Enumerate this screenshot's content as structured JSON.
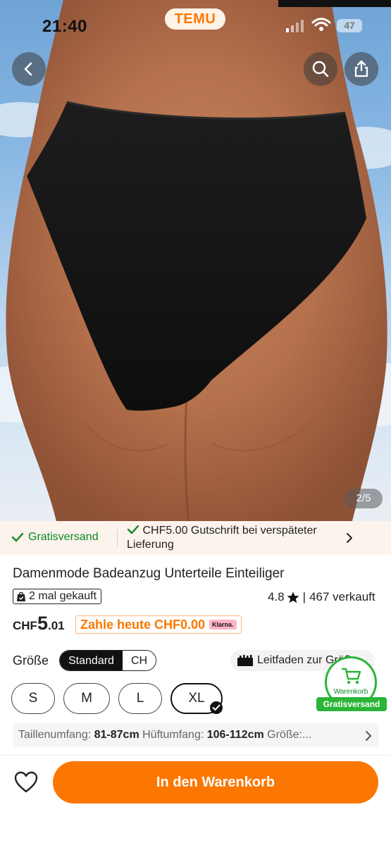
{
  "status_bar": {
    "time": "21:40",
    "app_name": "TEMU",
    "battery": "47"
  },
  "gallery": {
    "counter": "2/5"
  },
  "shipping": {
    "free_shipping": "Gratisversand",
    "credit_line1": "CHF5.00 Gutschrift bei verspäteter",
    "credit_line2": "Lieferung"
  },
  "product": {
    "title": "Damenmode Badeanzug Unterteile Einteiliger",
    "bought_badge": "2 mal gekauft",
    "rating": "4.8",
    "sold": "467 verkauft",
    "price_currency": "CHF",
    "price_whole": "5",
    "price_decimal": ".01",
    "pay_today": "Zahle heute CHF0.00",
    "klarna": "Klarna."
  },
  "size_section": {
    "label": "Größe",
    "standards": [
      "Standard",
      "CH"
    ],
    "active_standard": "Standard",
    "guide": "Leitfaden zur Größe",
    "sizes": [
      "S",
      "M",
      "L",
      "XL"
    ],
    "selected_size": "XL"
  },
  "floating_cart": {
    "label": "Warenkorb",
    "banner": "Gratisversand"
  },
  "measurements": {
    "waist_label": "Taillenumfang:",
    "waist_value": "81-87cm",
    "hip_label": "Hüftumfang:",
    "hip_value": "106-112cm",
    "size_label": "Größe:..."
  },
  "bottom_bar": {
    "add_to_cart": "In den Warenkorb"
  },
  "colors": {
    "accent": "#fb7701",
    "success": "#0a8a26",
    "cart_green": "#2bb538"
  },
  "icons": [
    "chevron-left-icon",
    "search-icon",
    "share-icon",
    "check-icon",
    "chevron-right-icon",
    "bag-icon",
    "star-icon",
    "ruler-icon",
    "cart-icon",
    "heart-icon"
  ]
}
